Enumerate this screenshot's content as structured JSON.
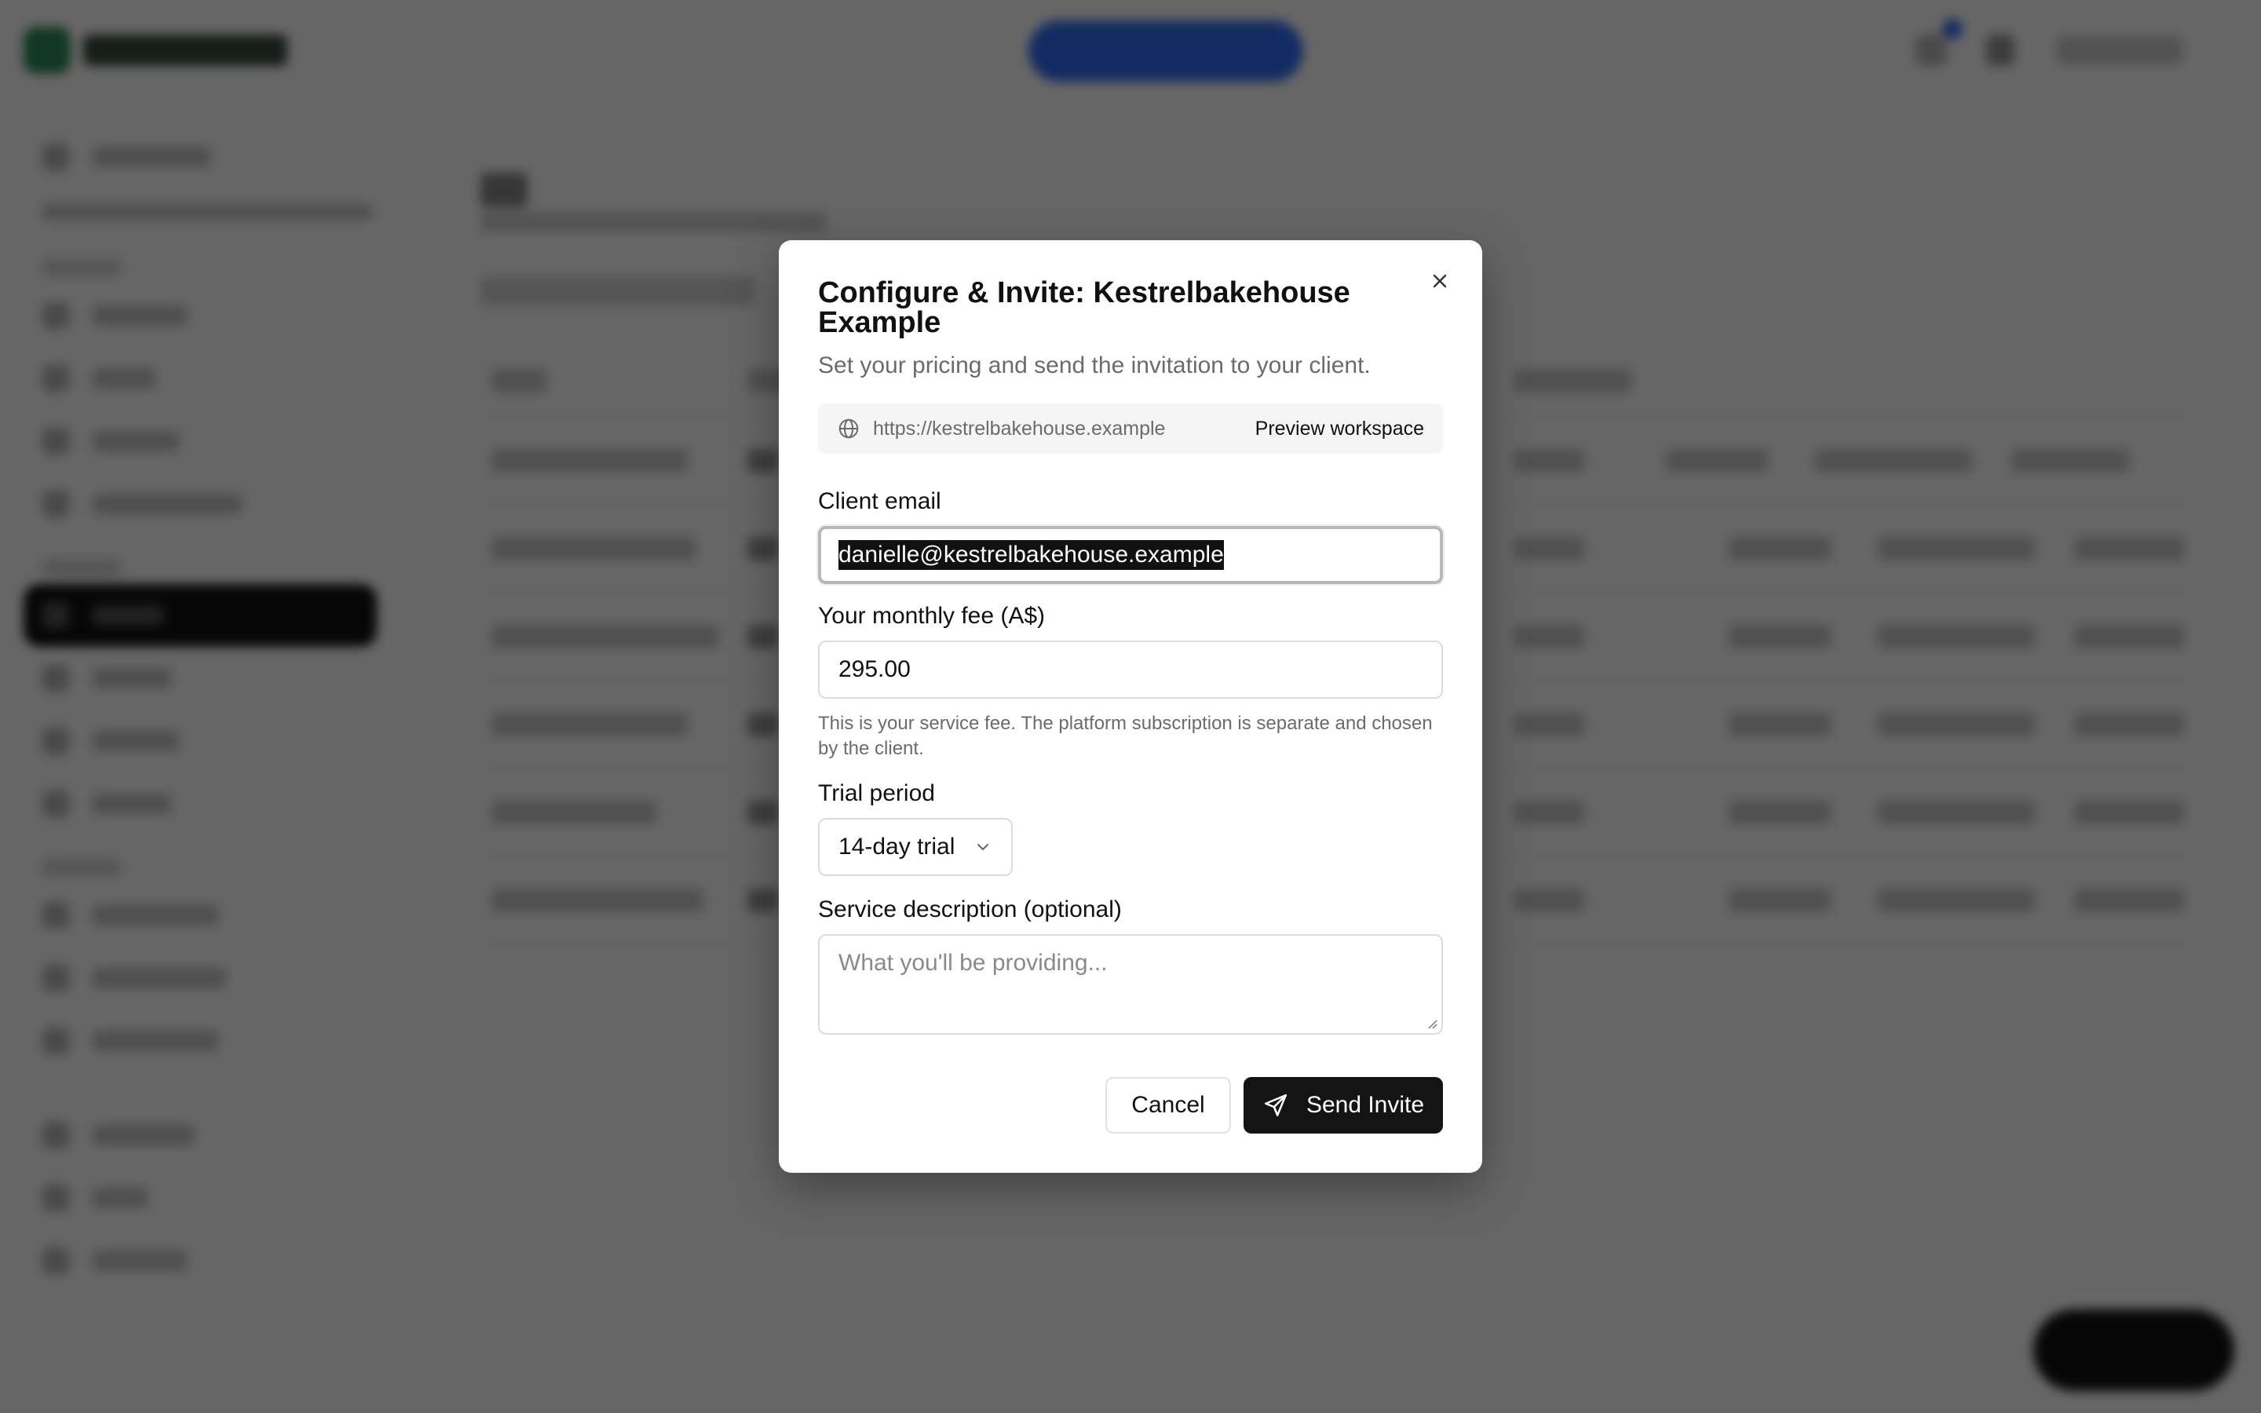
{
  "modal": {
    "title": "Configure & Invite: Kestrelbakehouse Example",
    "subtitle": "Set your pricing and send the invitation to your client.",
    "workspace_url": "https://kestrelbakehouse.example",
    "preview_label": "Preview workspace",
    "client_email_label": "Client email",
    "client_email_value": "danielle@kestrelbakehouse.example",
    "fee_label": "Your monthly fee (A$)",
    "fee_value": "295.00",
    "fee_help": "This is your service fee. The platform subscription is separate and chosen by the client.",
    "trial_label": "Trial period",
    "trial_selected": "14-day trial",
    "description_label": "Service description (optional)",
    "description_placeholder": "What you'll be providing...",
    "cancel_label": "Cancel",
    "send_label": "Send Invite"
  },
  "icons": {
    "close": "close-icon",
    "globe": "globe-icon",
    "chevron": "chevron-down-icon",
    "send": "send-icon",
    "bell": "bell-icon"
  },
  "colors": {
    "overlay": "rgba(0,0,0,0.60)",
    "primary_button": "#141414",
    "top_cta": "#2f6df6",
    "brand": "#2d8a5a"
  }
}
